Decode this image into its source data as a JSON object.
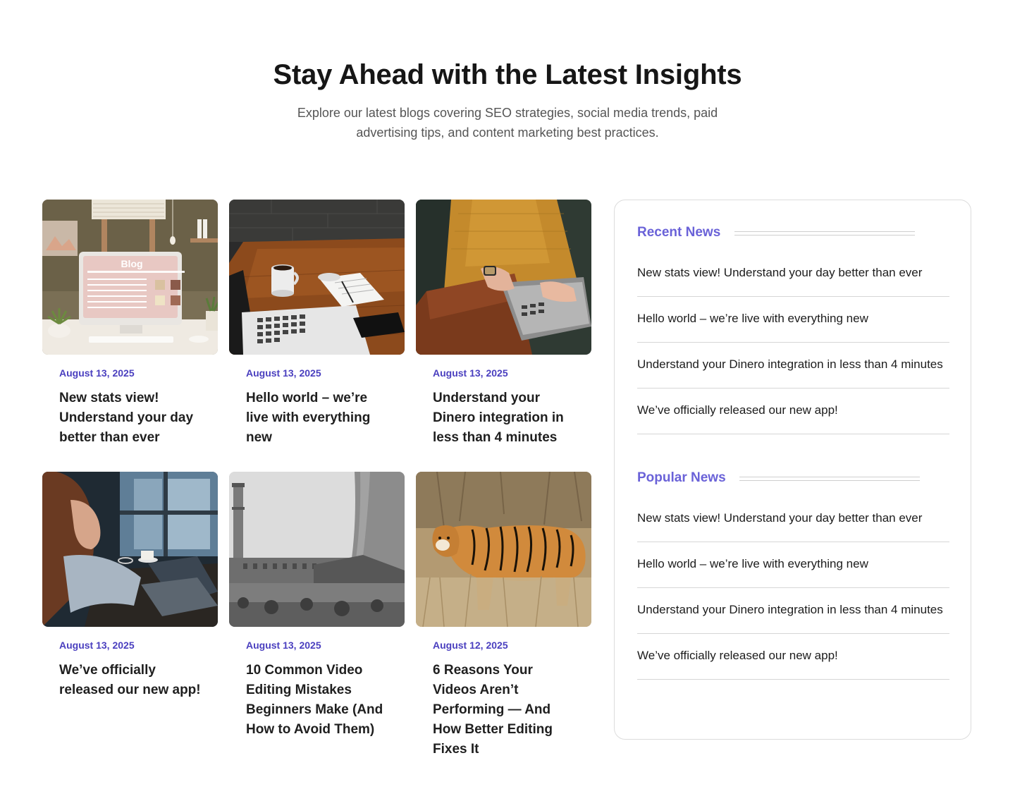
{
  "header": {
    "title": "Stay Ahead with the Latest Insights",
    "subtitle": "Explore our latest blogs covering SEO strategies, social media trends, paid advertising tips, and content marketing best practices."
  },
  "posts": [
    {
      "date": "August 13, 2025",
      "title": "New stats view! Understand your day better than ever",
      "image": "blog-desk-illustration",
      "image_label": "Blog"
    },
    {
      "date": "August 13, 2025",
      "title": "Hello world – we’re live with everything new",
      "image": "laptop-coffee-desk"
    },
    {
      "date": "August 13, 2025",
      "title": "Understand your Dinero integration in less than 4 minutes",
      "image": "hands-typing-laptop"
    },
    {
      "date": "August 13, 2025",
      "title": "We’ve officially released our new app!",
      "image": "woman-working-laptop"
    },
    {
      "date": "August 13, 2025",
      "title": "10 Common Video Editing Mistakes Beginners Make (And How to Avoid Them)",
      "image": "industrial-cooling-tower"
    },
    {
      "date": "August 12, 2025",
      "title": "6 Reasons Your Videos Aren’t Performing — And How Better Editing Fixes It",
      "image": "tiger-in-grass"
    }
  ],
  "sidebar": {
    "recent_title": "Recent News",
    "recent": [
      "New stats view! Understand your day better than ever",
      "Hello world – we’re live with everything new",
      "Understand your Dinero integration in less than 4 minutes",
      "We’ve officially released our new app!"
    ],
    "popular_title": "Popular News",
    "popular": [
      "New stats view! Understand your day better than ever",
      "Hello world – we’re live with everything new",
      "Understand your Dinero integration in less than 4 minutes",
      "We’ve officially released our new app!"
    ]
  },
  "colors": {
    "date": "#4a3fbf",
    "section_heading": "#6a62d8",
    "divider": "#d6d6d6"
  }
}
